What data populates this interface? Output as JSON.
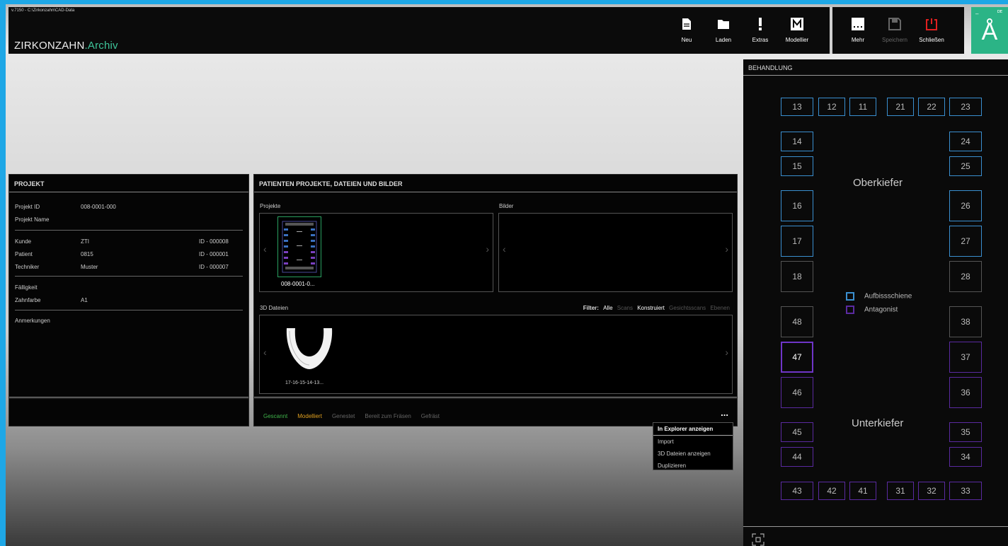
{
  "window": {
    "path": "v.7150 - C:\\Zirkonzahn\\CAD-Data",
    "brand": "ZIRKONZAHN",
    "brand_suffix": ".Archiv"
  },
  "toolbar": [
    {
      "label": "Neu",
      "icon": "file-icon"
    },
    {
      "label": "Laden",
      "icon": "folder-icon"
    },
    {
      "label": "Extras",
      "icon": "exclamation-icon"
    },
    {
      "label": "Modellier",
      "icon": "m-icon"
    }
  ],
  "toolbar2": [
    {
      "label": "Mehr",
      "icon": "more-icon",
      "enabled": true
    },
    {
      "label": "Speichern",
      "icon": "save-icon",
      "enabled": false
    },
    {
      "label": "Schließen",
      "icon": "power-icon",
      "enabled": true
    }
  ],
  "logo": {
    "letter": "Å",
    "min": "–",
    "flag": "ᴰᴱ"
  },
  "projekt": {
    "title": "PROJEKT",
    "projekt_id_label": "Projekt ID",
    "projekt_id": "008-0001-000",
    "projekt_name_label": "Projekt Name",
    "kunde_label": "Kunde",
    "kunde": "ZTI",
    "kunde_id": "ID - 000008",
    "patient_label": "Patient",
    "patient": "0815",
    "patient_id": "ID - 000001",
    "techniker_label": "Techniker",
    "techniker": "Muster",
    "techniker_id": "ID - 000007",
    "faelligkeit_label": "Fälligkeit",
    "zahnfarbe_label": "Zahnfarbe",
    "zahnfarbe": "A1",
    "anmerkungen_label": "Anmerkungen"
  },
  "patienten": {
    "title": "PATIENTEN PROJEKTE, DATEIEN UND BILDER",
    "projekte_label": "Projekte",
    "bilder_label": "Bilder",
    "project_thumb_caption": "008-0001-0...",
    "dateien_label": "3D Dateien",
    "file_caption": "17-16-15-14-13...",
    "filter_label": "Filter:",
    "filters": [
      {
        "label": "Alle",
        "active": true
      },
      {
        "label": "Scans",
        "active": false
      },
      {
        "label": "Konstruiert",
        "active": true
      },
      {
        "label": "Gesichtsscans",
        "active": false
      },
      {
        "label": "Ebenen",
        "active": false
      }
    ]
  },
  "status": [
    {
      "label": "Gescannt",
      "color": "#3fb24a"
    },
    {
      "label": "Modelliert",
      "color": "#e0a020"
    },
    {
      "label": "Genestet",
      "color": "#666666"
    },
    {
      "label": "Bereit zum Fräsen",
      "color": "#666666"
    },
    {
      "label": "Gefräst",
      "color": "#666666"
    }
  ],
  "more_dots": "...",
  "context_menu": [
    "In Explorer anzeigen",
    "Import",
    "3D Dateien anzeigen",
    "Duplizieren"
  ],
  "behandlung": {
    "title": "BEHANDLUNG",
    "oberkiefer": "Oberkiefer",
    "unterkiefer": "Unterkiefer",
    "legend": [
      {
        "label": "Aufbissschiene",
        "color": "#3a8fd0"
      },
      {
        "label": "Antagonist",
        "color": "#5a2aa0"
      }
    ],
    "teeth": {
      "t13": "13",
      "t12": "12",
      "t11": "11",
      "t21": "21",
      "t22": "22",
      "t23": "23",
      "t14": "14",
      "t24": "24",
      "t15": "15",
      "t25": "25",
      "t16": "16",
      "t26": "26",
      "t17": "17",
      "t27": "27",
      "t18": "18",
      "t28": "28",
      "t48": "48",
      "t38": "38",
      "t47": "47",
      "t37": "37",
      "t46": "46",
      "t36": "36",
      "t45": "45",
      "t35": "35",
      "t44": "44",
      "t34": "34",
      "t43": "43",
      "t42": "42",
      "t41": "41",
      "t31": "31",
      "t32": "32",
      "t33": "33"
    }
  }
}
